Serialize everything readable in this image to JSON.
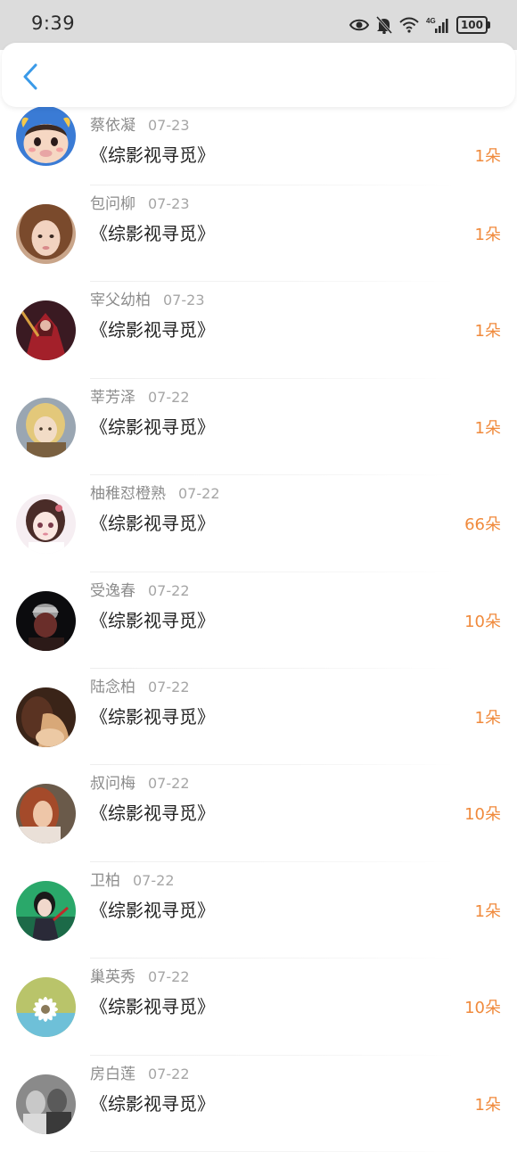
{
  "status_bar": {
    "time": "9:39",
    "battery": "100",
    "network": "4G"
  },
  "header": {
    "back_icon": "chevron-left-icon",
    "accent_color": "#3a9ae8"
  },
  "colors": {
    "amount": "#f08a3c",
    "name": "#8c8c8c",
    "title": "#222222"
  },
  "records": [
    {
      "name": "蔡依凝",
      "date": "07-23",
      "book": "《综影视寻觅》",
      "amount": "1朵",
      "avatar": "cartoon-bull-avatar"
    },
    {
      "name": "包问柳",
      "date": "07-23",
      "book": "《综影视寻觅》",
      "amount": "1朵",
      "avatar": "girl-photo-avatar"
    },
    {
      "name": "宰父幼柏",
      "date": "07-23",
      "book": "《综影视寻觅》",
      "amount": "1朵",
      "avatar": "red-warrior-avatar"
    },
    {
      "name": "莘芳泽",
      "date": "07-22",
      "book": "《综影视寻觅》",
      "amount": "1朵",
      "avatar": "anime-blonde-avatar"
    },
    {
      "name": "柚稚怼橙熟",
      "date": "07-22",
      "book": "《综影视寻觅》",
      "amount": "66朵",
      "avatar": "anime-girl-avatar"
    },
    {
      "name": "受逸春",
      "date": "07-22",
      "book": "《综影视寻觅》",
      "amount": "10朵",
      "avatar": "dark-character-avatar"
    },
    {
      "name": "陆念柏",
      "date": "07-22",
      "book": "《综影视寻觅》",
      "amount": "1朵",
      "avatar": "warm-photo-avatar"
    },
    {
      "name": "叔问梅",
      "date": "07-22",
      "book": "《综影视寻觅》",
      "amount": "10朵",
      "avatar": "red-hair-avatar"
    },
    {
      "name": "卫柏",
      "date": "07-22",
      "book": "《综影视寻觅》",
      "amount": "1朵",
      "avatar": "green-anime-avatar"
    },
    {
      "name": "巢英秀",
      "date": "07-22",
      "book": "《综影视寻觅》",
      "amount": "10朵",
      "avatar": "daisy-cup-avatar"
    },
    {
      "name": "房白莲",
      "date": "07-22",
      "book": "《综影视寻觅》",
      "amount": "1朵",
      "avatar": "grayscale-photo-avatar"
    }
  ]
}
